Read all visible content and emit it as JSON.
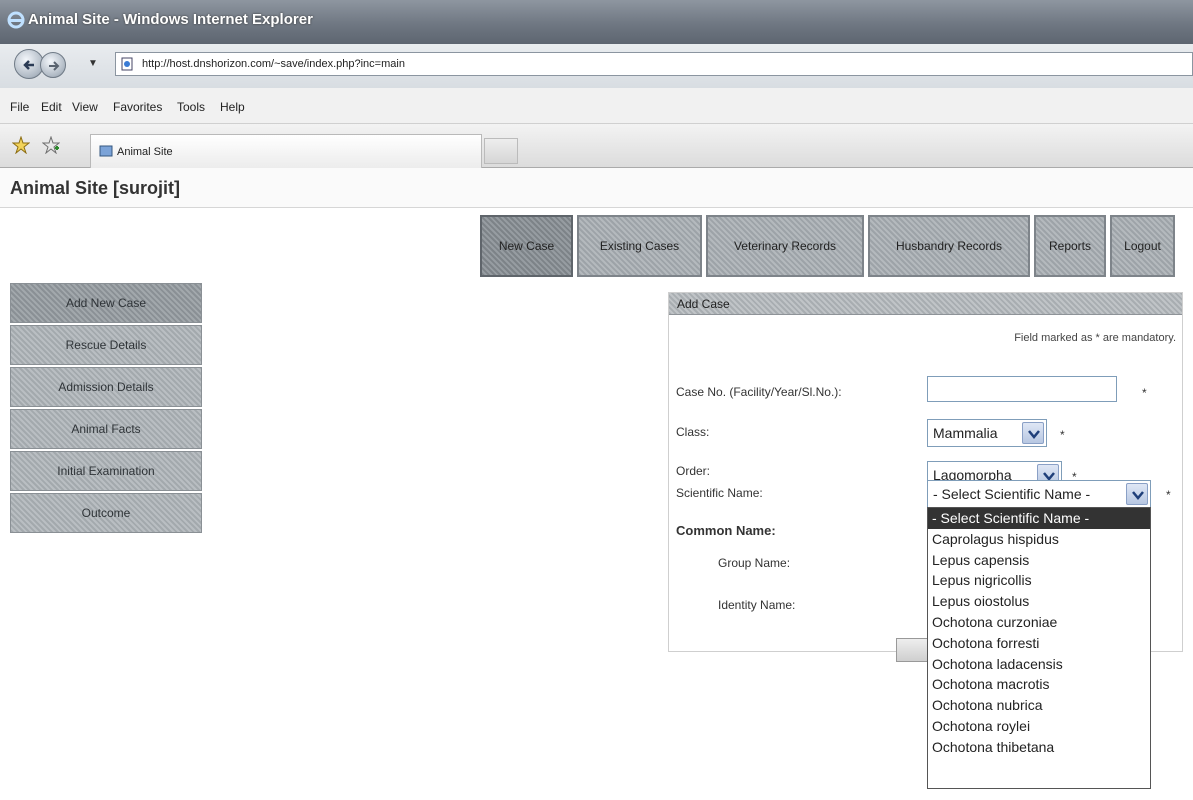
{
  "window": {
    "title": "Animal Site - Windows Internet Explorer"
  },
  "address_bar": {
    "url": "http://host.dnshorizon.com/~save/index.php?inc=main"
  },
  "menu": [
    "File",
    "Edit",
    "View",
    "Favorites",
    "Tools",
    "Help"
  ],
  "tab": {
    "label": "Animal Site"
  },
  "site": {
    "title": "Animal Site [surojit]"
  },
  "top_nav": [
    "New Case",
    "Existing Cases",
    "Veterinary Records",
    "Husbandry Records",
    "Reports",
    "Logout"
  ],
  "side_nav": [
    "Add New Case",
    "Rescue Details",
    "Admission Details",
    "Animal Facts",
    "Initial Examination",
    "Outcome"
  ],
  "form": {
    "title": "Add Case",
    "mandatory_note": "Field marked as * are mandatory.",
    "case_no_label": "Case No. (Facility/Year/Sl.No.):",
    "class_label": "Class:",
    "class_value": "Mammalia",
    "order_label": "Order:",
    "order_value": "Lagomorpha",
    "scientific_label": "Scientific Name:",
    "scientific_value": "- Select Scientific Name -",
    "common_name_label": "Common Name:",
    "group_label": "Group Name:",
    "identity_label": "Identity Name:",
    "required_marker": "*"
  },
  "scientific_options": [
    "- Select Scientific Name -",
    "Caprolagus hispidus",
    "Lepus capensis",
    "Lepus nigricollis",
    "Lepus oiostolus",
    "Ochotona curzoniae",
    "Ochotona forresti",
    "Ochotona ladacensis",
    "Ochotona macrotis",
    "Ochotona nubrica",
    "Ochotona roylei",
    "Ochotona thibetana"
  ]
}
